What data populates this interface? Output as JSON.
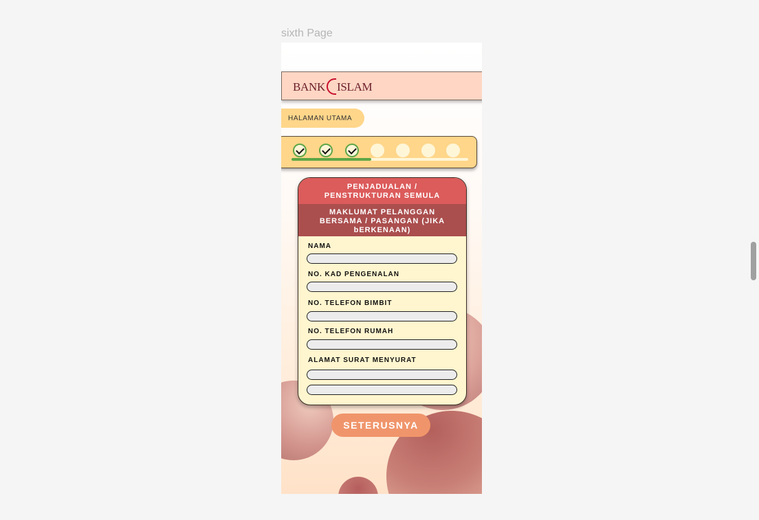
{
  "frame": {
    "label": "sixth Page"
  },
  "header": {
    "logo_left": "BANK",
    "logo_right": "ISLAM"
  },
  "nav": {
    "home_label": "HALAMAN UTAMA"
  },
  "progress": {
    "steps_total": 7,
    "steps_done": 3,
    "fill_fraction": 0.45,
    "colors": {
      "done": "#5ea647",
      "pending": "#fff6d8"
    }
  },
  "form": {
    "title_line1": "PENJADUALAN /",
    "title_line2": "PENSTRUKTURAN SEMULA",
    "subtitle_line1": "MAKLUMAT PELANGGAN",
    "subtitle_line2": "BERSAMA / PASANGAN (JIKA",
    "subtitle_line3": "bERKENAAN)",
    "fields": {
      "nama": {
        "label": "NAMA",
        "value": ""
      },
      "ic": {
        "label": "NO. KAD PENGENALAN",
        "value": ""
      },
      "mobile": {
        "label": "NO. TELEFON BIMBIT",
        "value": ""
      },
      "home_phone": {
        "label": "NO. TELEFON RUMAH",
        "value": ""
      },
      "address": {
        "label": "ALAMAT SURAT MENYURAT",
        "value_line1": "",
        "value_line2": ""
      }
    }
  },
  "actions": {
    "next_label": "SETERUSNYA"
  },
  "colors": {
    "accent_red": "#dc5b5b",
    "accent_dark_red": "#ab4e4e",
    "button_orange": "#f0956b",
    "panel_yellow": "#ffd68a",
    "header_peach": "#ffd6c4"
  }
}
